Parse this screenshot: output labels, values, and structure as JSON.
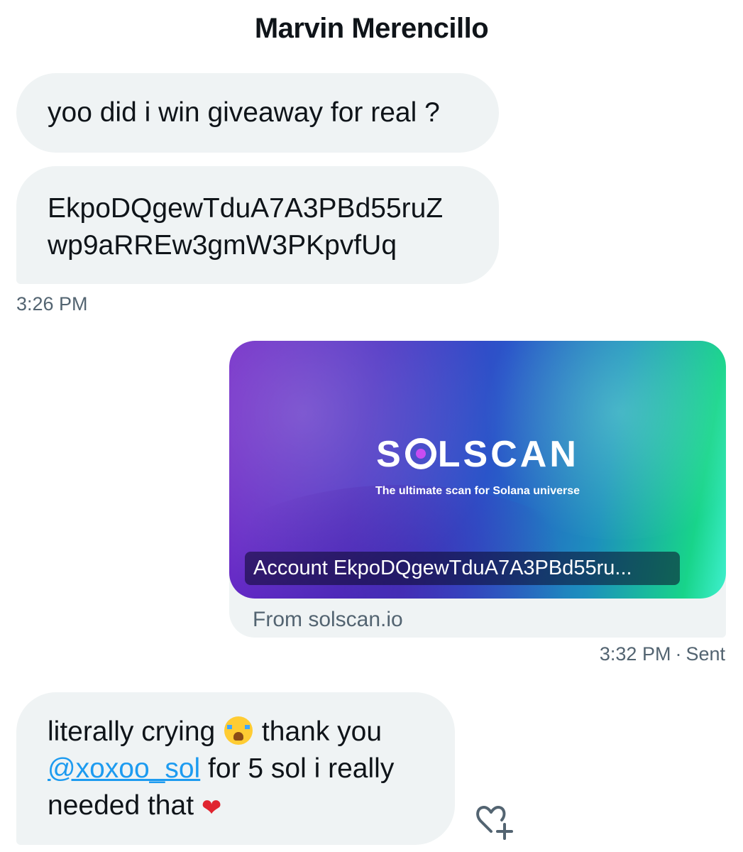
{
  "header": {
    "title": "Marvin Merencillo"
  },
  "messages": {
    "m1": {
      "text": "yoo did i win giveaway for real ?"
    },
    "m2": {
      "line1": "EkpoDQgewTduA7A3PBd55ruZ",
      "line2": "wp9aRREw3gmW3PKpvfUq"
    },
    "time1": "3:26 PM",
    "card": {
      "logo_left": "S",
      "logo_right": "LSCAN",
      "tagline": "The ultimate scan for Solana universe",
      "account": "Account EkpoDQgewTduA7A3PBd55ru...",
      "from": "From solscan.io"
    },
    "time2": "3:32 PM",
    "sent": "Sent",
    "m3": {
      "part1": "literally crying ",
      "part2": " thank you",
      "mention": "@xoxoo_sol",
      "part3": " for 5 sol i really",
      "part4": "needed that "
    }
  },
  "icons": {
    "crying": "loudly-crying-face-emoji",
    "heart": "red-heart-emoji",
    "react": "add-reaction-heart-icon"
  },
  "colors": {
    "bubble": "#eff3f4",
    "secondary_text": "#536471",
    "link": "#1d9bf0",
    "heart": "#e0242f"
  }
}
